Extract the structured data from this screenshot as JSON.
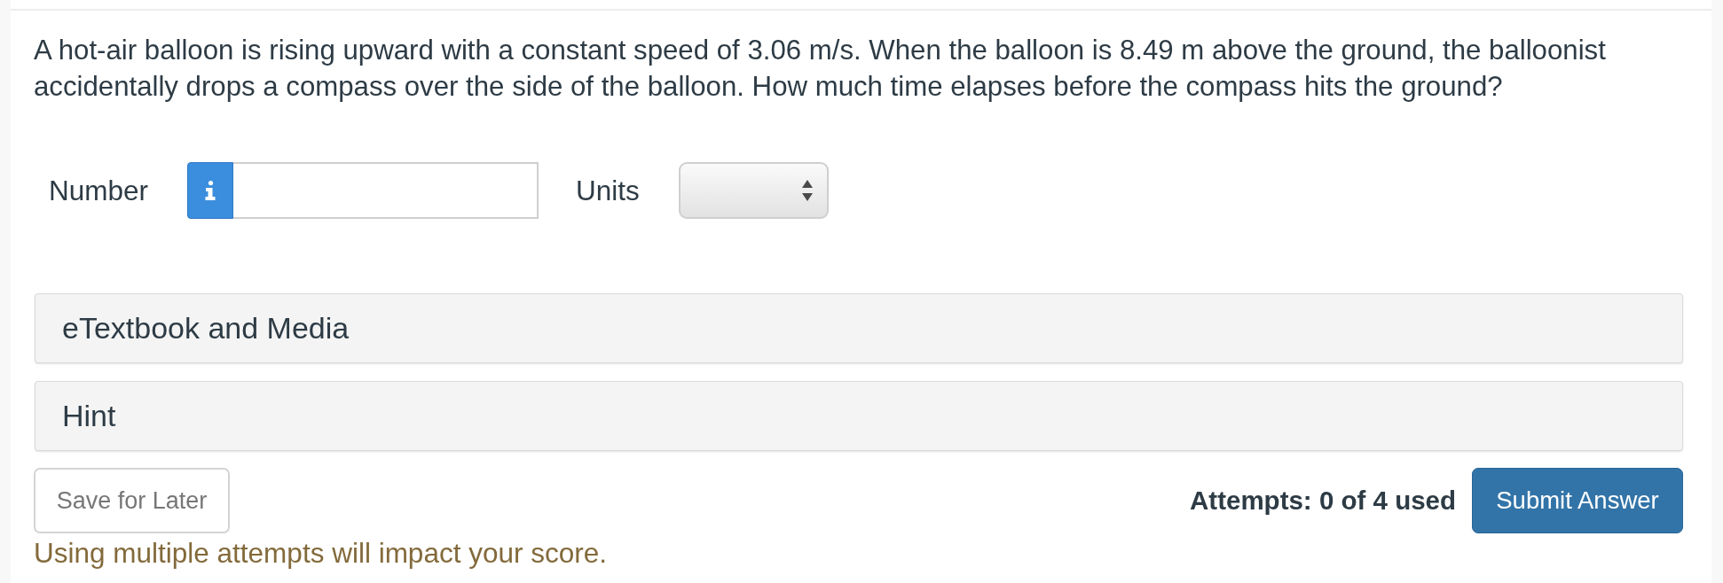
{
  "question": {
    "text": "A hot-air balloon is rising upward with a constant speed of 3.06 m/s. When the balloon is 8.49 m above the ground, the balloonist accidentally drops a compass over the side of the balloon. How much time elapses before the compass hits the ground?"
  },
  "answer_row": {
    "number_label": "Number",
    "units_label": "Units"
  },
  "panels": [
    {
      "title": "eTextbook and Media"
    },
    {
      "title": "Hint"
    }
  ],
  "footer": {
    "save_button": "Save for Later",
    "attempts": "Attempts: 0 of 4 used",
    "submit_button": "Submit Answer",
    "warning": "Using multiple attempts will impact your score."
  }
}
